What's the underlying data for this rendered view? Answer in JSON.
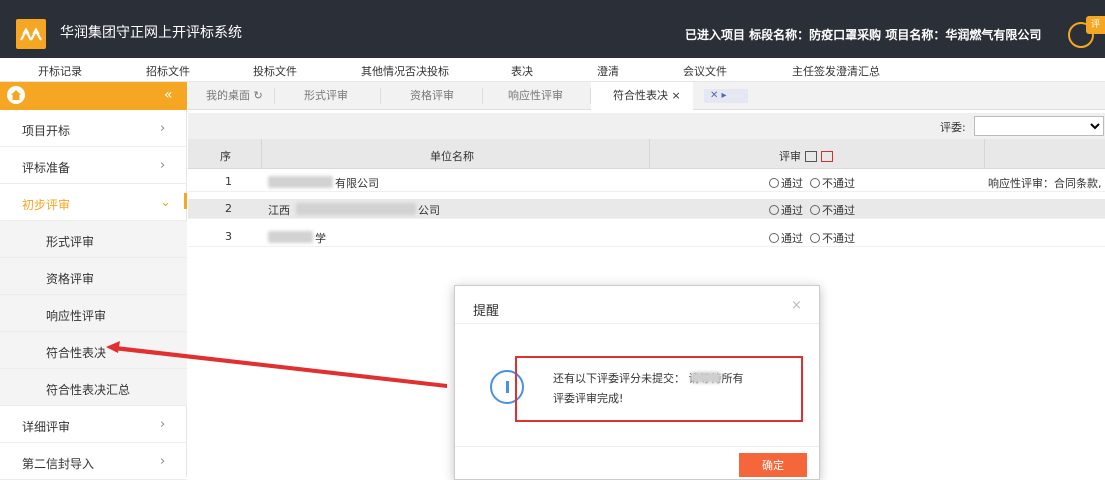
{
  "header": {
    "app_title": "华润集团守正网上开评标系统",
    "project_info": "已进入项目 标段名称：防疫口罩采购    项目名称：华润燃气有限公司",
    "badge": "评",
    "accent_color": "#f5a623"
  },
  "top_menu": [
    "开标记录",
    "招标文件",
    "投标文件",
    "其他情况否决投标",
    "表决",
    "澄清",
    "会议文件",
    "主任签发澄清汇总"
  ],
  "sidebar": {
    "collapse_icon": "«",
    "items": [
      {
        "label": "项目开标",
        "arrow": "›"
      },
      {
        "label": "评标准备",
        "arrow": "›"
      },
      {
        "label": "初步评审",
        "arrow": "⌄"
      },
      {
        "label": "形式评审"
      },
      {
        "label": "资格评审"
      },
      {
        "label": "响应性评审"
      },
      {
        "label": "符合性表决"
      },
      {
        "label": "符合性表决汇总"
      },
      {
        "label": "详细评审",
        "arrow": "›"
      },
      {
        "label": "第二信封导入",
        "arrow": "›"
      }
    ]
  },
  "tabs": [
    {
      "label": "我的桌面 ↻"
    },
    {
      "label": "形式评审"
    },
    {
      "label": "资格评审"
    },
    {
      "label": "响应性评审"
    },
    {
      "label": "符合性表决 ×"
    }
  ],
  "tab_nav": "✕ ▸",
  "filter": {
    "label": "评委:",
    "selected": ""
  },
  "table": {
    "columns": [
      "序",
      "单位名称",
      "评审"
    ],
    "rows": [
      {
        "no": "1",
        "name": "有限公司",
        "pass": "通过",
        "fail": "不通过",
        "note": "响应性评审：合同条款,"
      },
      {
        "no": "2",
        "name": "江西",
        "name2": "公司",
        "pass": "通过",
        "fail": "不通过",
        "note": ""
      },
      {
        "no": "3",
        "name": "学",
        "pass": "通过",
        "fail": "不通过",
        "note": ""
      }
    ]
  },
  "dialog": {
    "title": "提醒",
    "close": "×",
    "message_line1": "还有以下评委评分未提交：        请等待所有",
    "message_line2": "评委评审完成!",
    "ok_label": "确定"
  }
}
